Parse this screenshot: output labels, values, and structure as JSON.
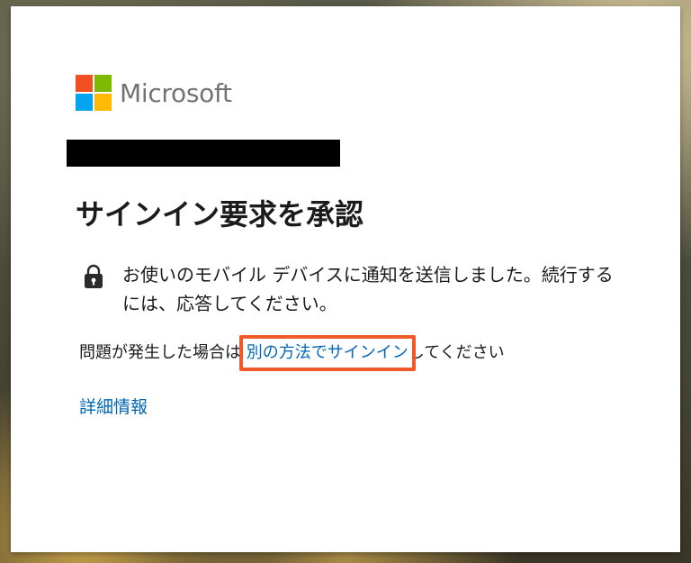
{
  "brand": {
    "name": "Microsoft",
    "colors": {
      "red": "#f25022",
      "green": "#7fba00",
      "blue": "#00a4ef",
      "yellow": "#ffb900"
    }
  },
  "dialog": {
    "title": "サインイン要求を承認",
    "notice": "お使いのモバイル デバイスに通知を送信しました。続行するには、応答してください。",
    "lock_icon": "lock-icon",
    "problem_prefix": "問題が発生した場合は",
    "alt_link_label": "別の方法でサインイン",
    "problem_suffix": "してください",
    "more_info_label": "詳細情報",
    "link_color": "#0067b8",
    "highlight_color": "#f0582a"
  }
}
